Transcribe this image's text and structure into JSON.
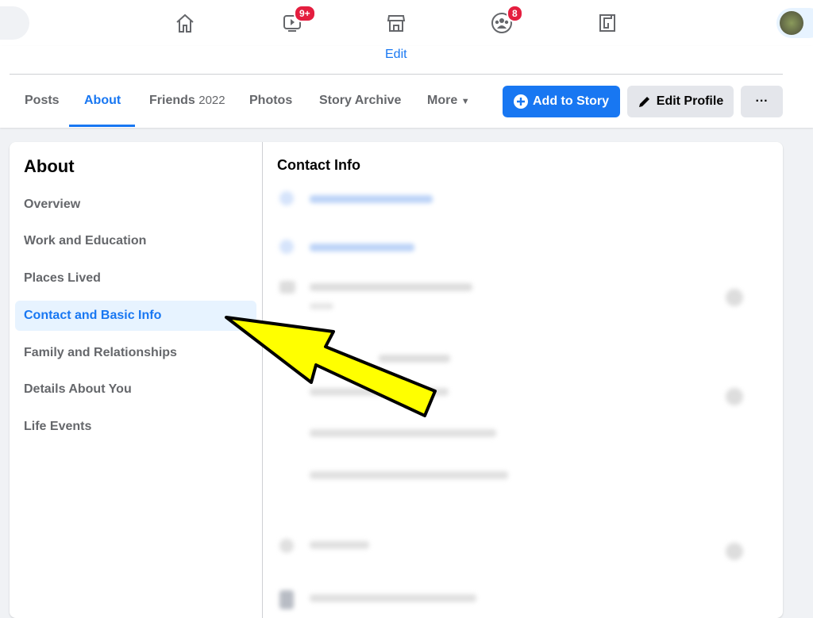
{
  "topnav": {
    "items": [
      {
        "icon": "home-icon"
      },
      {
        "icon": "watch-icon",
        "badge": "9+"
      },
      {
        "icon": "marketplace-icon"
      },
      {
        "icon": "groups-icon",
        "badge": "8"
      },
      {
        "icon": "gaming-icon"
      }
    ]
  },
  "profile": {
    "edit_link": "Edit",
    "tabs": [
      {
        "label": "Posts"
      },
      {
        "label": "About",
        "active": true
      },
      {
        "label": "Friends",
        "count": "2022"
      },
      {
        "label": "Photos"
      },
      {
        "label": "Story Archive"
      },
      {
        "label": "More"
      }
    ],
    "add_story": "Add to Story",
    "edit_profile": "Edit Profile",
    "more_actions": "···"
  },
  "about": {
    "title": "About",
    "items": [
      "Overview",
      "Work and Education",
      "Places Lived",
      "Contact and Basic Info",
      "Family and Relationships",
      "Details About You",
      "Life Events"
    ],
    "active_index": 3
  },
  "main": {
    "section_title": "Contact Info"
  },
  "colors": {
    "accent": "#1877f2",
    "annotation_arrow": "#ffff00"
  }
}
